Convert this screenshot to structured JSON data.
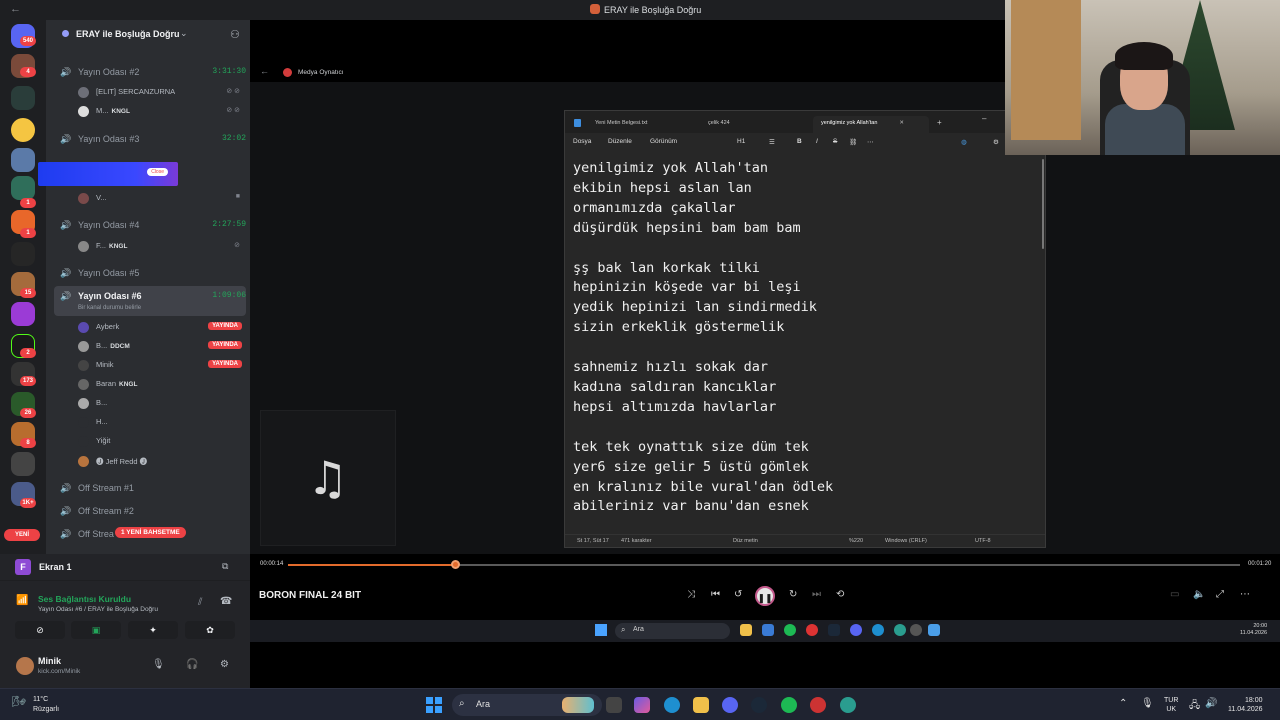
{
  "window": {
    "title": "ERAY ile Boşluğa Doğru",
    "back_icon": "←"
  },
  "server_rail": {
    "badges": [
      "540",
      "4",
      "1",
      "1",
      "15",
      "2",
      "173",
      "26",
      "8",
      "1K+"
    ],
    "yeni": "YENİ"
  },
  "guild": {
    "name": "ERAY ile Boşluğa Doğru"
  },
  "channels": [
    {
      "name": "Yayın Odası #2",
      "time": "3:31:30"
    },
    {
      "name": "Yayın Odası #3",
      "time": "32:02"
    },
    {
      "name": "Yayın Odası #4",
      "time": "2:27:59"
    },
    {
      "name": "Yayın Odası #5",
      "time": ""
    },
    {
      "name": "Yayın Odası #6",
      "time": "1:09:06",
      "status": "Bir kanal durumu belirle"
    },
    {
      "name": "Off Stream #1",
      "time": ""
    },
    {
      "name": "Off Stream #2",
      "time": ""
    },
    {
      "name": "Off Strea",
      "time": ""
    }
  ],
  "members_room2": [
    {
      "name": "[ELIT] SERCANZURNA",
      "tag": ""
    },
    {
      "name": "M...",
      "tag": "KNGL"
    }
  ],
  "members_room3": [
    {
      "name": "V...",
      "tag": ""
    }
  ],
  "members_room4": [
    {
      "name": "F...",
      "tag": "KNGL"
    }
  ],
  "members_room6": [
    {
      "name": "Ayberk",
      "tag": "",
      "live": "YAYINDA"
    },
    {
      "name": "B...",
      "tag": "DDCM",
      "live": "YAYINDA"
    },
    {
      "name": "Minik",
      "tag": "",
      "live": "YAYINDA"
    },
    {
      "name": "Baran",
      "tag": "KNGL",
      "live": ""
    },
    {
      "name": "B...",
      "tag": "",
      "live": ""
    },
    {
      "name": "H...",
      "tag": "",
      "live": ""
    },
    {
      "name": "Yiğit",
      "tag": "",
      "live": ""
    },
    {
      "name": "🅙 Jeff Redd 🅙",
      "tag": "",
      "live": ""
    }
  ],
  "overlay_close": "Close",
  "new_pill": "1 YENİ BAHSETME",
  "ekran": {
    "letter": "F",
    "label": "Ekran 1"
  },
  "voice": {
    "status": "Ses Bağlantısı Kuruldu",
    "channel": "Yayın Odası #6 / ERAY ile Boşluğa Doğru"
  },
  "user": {
    "name": "Minik",
    "status": "kick.com/Minik"
  },
  "media": {
    "header": "Medya Oynatıcı"
  },
  "notepad": {
    "tabs": [
      "Yeni Metin Belgesi.txt",
      "çelik 424",
      "yenilgimiz yok Allah'tan"
    ],
    "menu": [
      "Dosya",
      "Düzenle",
      "Görünüm",
      "H1"
    ],
    "lines": [
      "yenilgimiz yok Allah'tan",
      "ekibin hepsi aslan lan",
      "ormanımızda çakallar",
      "düşürdük hepsini bam bam bam",
      "",
      "şş bak lan korkak tilki",
      "hepinizin köşede var bi leşi",
      "yedik hepinizi lan sindirmedik",
      "sizin erkeklik göstermelik",
      "",
      "sahnemiz hızlı sokak dar",
      "kadına saldıran kancıklar",
      "hepsi altımızda havlarlar",
      "",
      "tek tek oynattık size düm tek",
      "yer6 size gelir 5 üstü gömlek",
      "en kralınız bile vural'dan ödlek",
      "abileriniz var banu'dan esnek"
    ],
    "status": {
      "position": "St 17, Süt 17",
      "chars": "471 karakter",
      "format": "Düz metin",
      "zoom": "%220",
      "eol": "Windows (CRLF)",
      "encoding": "UTF-8"
    }
  },
  "player": {
    "elapsed": "00:00:14",
    "total": "00:01:20",
    "progress": 0.175,
    "track": "BORON FINAL 24 BIT"
  },
  "inner_taskbar": {
    "search": "Ara",
    "time": "20:00",
    "date": "11.04.2026"
  },
  "taskbar": {
    "weather_temp": "11°C",
    "weather_desc": "Rüzgarlı",
    "search": "Ara",
    "lang1": "TUR",
    "lang2": "UK",
    "time": "18:00",
    "date": "11.04.2026"
  },
  "colors": {
    "green": "#23a55a",
    "live_red": "#ed4245",
    "accent_orange": "#e36b2c"
  }
}
